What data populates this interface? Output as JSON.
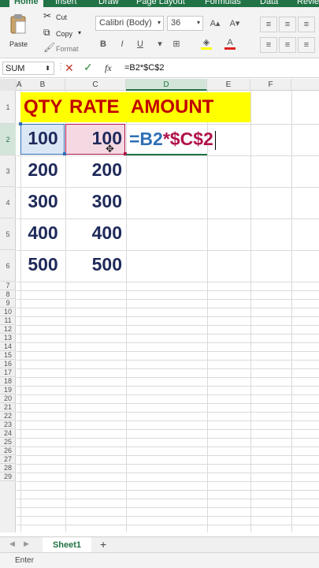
{
  "ribbon": {
    "tabs": [
      "Home",
      "Insert",
      "Draw",
      "Page Layout",
      "Formulas",
      "Data",
      "Revie"
    ],
    "clipboard": {
      "paste": "Paste",
      "cut": "Cut",
      "copy": "Copy",
      "format": "Format"
    },
    "font": {
      "name": "Calibri (Body)",
      "size": "36"
    },
    "format_buttons": [
      "B",
      "I",
      "U"
    ]
  },
  "formula_bar": {
    "name_box": "SUM",
    "fx": "fx",
    "formula": "=B2*$C$2"
  },
  "columns": [
    "A",
    "B",
    "C",
    "D",
    "E",
    "F"
  ],
  "rows": [
    "1",
    "2",
    "3",
    "4",
    "5",
    "6",
    "7",
    "8",
    "9",
    "10",
    "11",
    "12",
    "13",
    "14",
    "15",
    "16",
    "17",
    "18",
    "19",
    "20",
    "21",
    "22",
    "23",
    "24",
    "25",
    "26",
    "27",
    "28",
    "29"
  ],
  "sheet": {
    "header": {
      "qty": "QTY",
      "rate": "RATE",
      "amount": "AMOUNT"
    },
    "qty": [
      "100",
      "200",
      "300",
      "400",
      "500"
    ],
    "rate": [
      "100",
      "200",
      "300",
      "400",
      "500"
    ],
    "edit": {
      "part1": "=B2",
      "part2": "*",
      "part3": "$C$2"
    }
  },
  "tabs_bar": {
    "sheet": "Sheet1",
    "add": "+"
  },
  "status": {
    "mode": "Enter"
  },
  "colors": {
    "excel_green": "#217346",
    "header_fill": "#ffff00",
    "header_text": "#c00000",
    "ref_blue": "#2f6fb5",
    "ref_red": "#b0134b"
  }
}
